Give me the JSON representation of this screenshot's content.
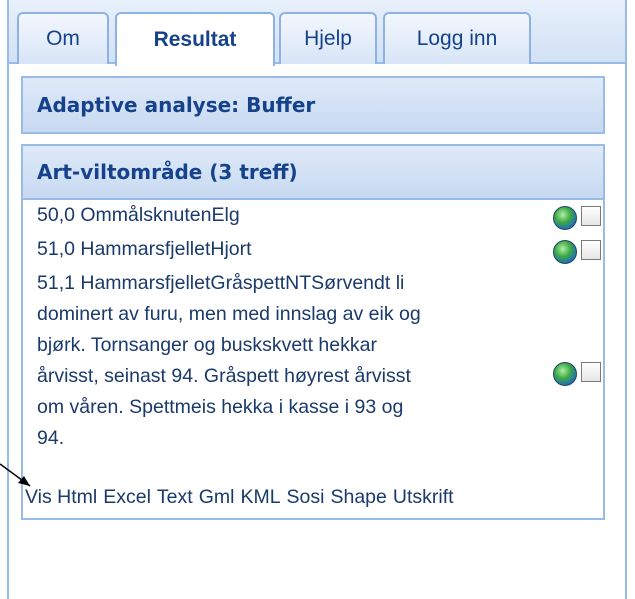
{
  "tabs": [
    {
      "label": "Om",
      "active": false
    },
    {
      "label": "Resultat",
      "active": true
    },
    {
      "label": "Hjelp",
      "active": false
    },
    {
      "label": "Logg inn",
      "active": false
    }
  ],
  "panels": {
    "analysis_title": "Adaptive analyse: Buffer",
    "results_title": "Art-viltområde (3 treff)"
  },
  "results": [
    {
      "text": "50,0 OmmålsknutenElg",
      "checked": false
    },
    {
      "text": "51,0 HammarsfjelletHjort",
      "checked": false
    },
    {
      "text": "51,1 HammarsfjelletGråspettNTSørvendt li dominert av furu, men med innslag av eik og bjørk. Tornsanger og buskskvett hekkar årvisst, seinast 94. Gråspett høyrest årvisst om våren. Spettmeis hekka i kasse i 93 og 94.",
      "checked": false
    }
  ],
  "result_lines_3": [
    "51,1 HammarsfjelletGråspettNTSørvendt li",
    "dominert av furu, men med innslag av eik og",
    "bjørk. Tornsanger og buskskvett hekkar",
    "årvisst, seinast 94. Gråspett høyrest årvisst",
    "om våren. Spettmeis hekka i kasse i 93 og",
    "94."
  ],
  "exports": [
    "Vis Html",
    "Excel",
    "Text",
    "Gml",
    "KML",
    "Sosi",
    "Shape",
    "Utskrift"
  ],
  "icons": {
    "globe": "globe-icon",
    "checkbox": "checkbox"
  },
  "colors": {
    "accent": "#15428b",
    "border": "#99bbe8",
    "text": "#1a3a6b"
  }
}
